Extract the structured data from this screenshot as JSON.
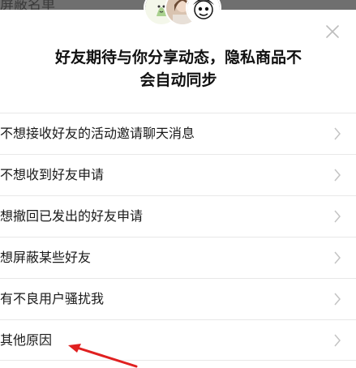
{
  "backdrop": {
    "title": "屏蔽名单"
  },
  "header": {
    "title_line1": "好友期待与你分享动态，隐私商品不",
    "title_line2": "会自动同步"
  },
  "icons": {
    "close": "close-icon",
    "chevron": "chevron-right-icon"
  },
  "reasons": [
    {
      "label": "不想接收好友的活动邀请聊天消息"
    },
    {
      "label": "不想收到好友申请"
    },
    {
      "label": "想撤回已发出的好友申请"
    },
    {
      "label": "想屏蔽某些好友"
    },
    {
      "label": "有不良用户骚扰我"
    },
    {
      "label": "其他原因"
    }
  ],
  "colors": {
    "annotation_arrow": "#e02020",
    "divider": "#e8e8e8",
    "chevron": "#c4c4c4"
  }
}
